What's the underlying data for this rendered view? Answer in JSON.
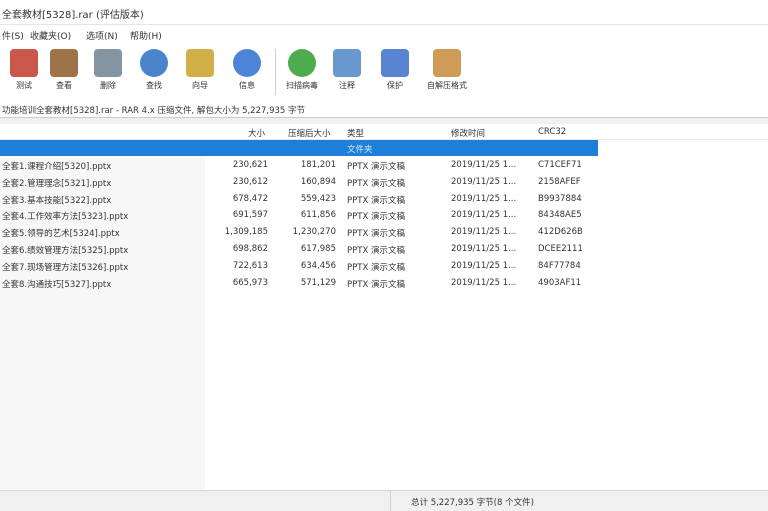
{
  "window": {
    "title": "全套教材[5328].rar (评估版本)"
  },
  "menu": {
    "items": [
      "件(S)",
      "收藏夹(O)",
      "选项(N)",
      "帮助(H)"
    ]
  },
  "toolbar": {
    "buttons": [
      {
        "label": "测试",
        "icon": "test-icon",
        "color": "#c0392b"
      },
      {
        "label": "查看",
        "icon": "book-icon",
        "color": "#8e5a2a"
      },
      {
        "label": "删除",
        "icon": "trash-icon",
        "color": "#6f8190"
      },
      {
        "label": "查找",
        "icon": "magnifier-icon",
        "color": "#2d6fc2"
      },
      {
        "label": "向导",
        "icon": "wand-icon",
        "color": "#c9a227"
      },
      {
        "label": "信息",
        "icon": "info-icon",
        "color": "#2f6fd0"
      },
      {
        "label": "扫描病毒",
        "icon": "virus-scan-icon",
        "color": "#2e9e2e"
      },
      {
        "label": "注释",
        "icon": "comment-icon",
        "color": "#4f86c6"
      },
      {
        "label": "保护",
        "icon": "shield-icon",
        "color": "#3b6fc9"
      },
      {
        "label": "自解压格式",
        "icon": "sfx-icon",
        "color": "#c8893a"
      }
    ]
  },
  "address": {
    "text": "功能培训全套教材[5328].rar - RAR 4.x 压缩文件, 解包大小为 5,227,935 字节"
  },
  "columns": {
    "size": "大小",
    "packed": "压缩后大小",
    "type": "类型",
    "modified": "修改时间",
    "crc": "CRC32"
  },
  "parent_row": {
    "type": "文件夹"
  },
  "files": [
    {
      "name": "全套1.课程介绍[5320].pptx",
      "size": "230,621",
      "packed": "181,201",
      "type": "PPTX 演示文稿",
      "modified": "2019/11/25 1...",
      "crc": "C71CEF71"
    },
    {
      "name": "全套2.管理理念[5321].pptx",
      "size": "230,612",
      "packed": "160,894",
      "type": "PPTX 演示文稿",
      "modified": "2019/11/25 1...",
      "crc": "2158AFEF"
    },
    {
      "name": "全套3.基本技能[5322].pptx",
      "size": "678,472",
      "packed": "559,423",
      "type": "PPTX 演示文稿",
      "modified": "2019/11/25 1...",
      "crc": "B9937884"
    },
    {
      "name": "全套4.工作效率方法[5323].pptx",
      "size": "691,597",
      "packed": "611,856",
      "type": "PPTX 演示文稿",
      "modified": "2019/11/25 1...",
      "crc": "84348AE5"
    },
    {
      "name": "全套5.领导的艺术[5324].pptx",
      "size": "1,309,185",
      "packed": "1,230,270",
      "type": "PPTX 演示文稿",
      "modified": "2019/11/25 1...",
      "crc": "412D626B"
    },
    {
      "name": "全套6.绩效管理方法[5325].pptx",
      "size": "698,862",
      "packed": "617,985",
      "type": "PPTX 演示文稿",
      "modified": "2019/11/25 1...",
      "crc": "DCEE2111"
    },
    {
      "name": "全套7.现场管理方法[5326].pptx",
      "size": "722,613",
      "packed": "634,456",
      "type": "PPTX 演示文稿",
      "modified": "2019/11/25 1...",
      "crc": "84F77784"
    },
    {
      "name": "全套8.沟通技巧[5327].pptx",
      "size": "665,973",
      "packed": "571,129",
      "type": "PPTX 演示文稿",
      "modified": "2019/11/25 1...",
      "crc": "4903AF11"
    }
  ],
  "status": {
    "total": "总计 5,227,935 字节(8 个文件)"
  }
}
